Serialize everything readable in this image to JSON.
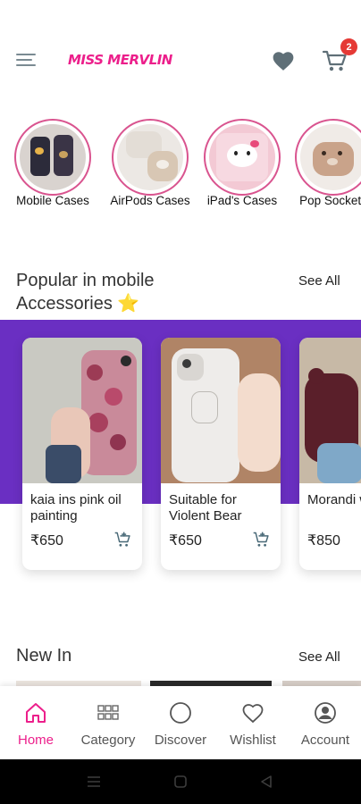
{
  "header": {
    "brand": "MISS MERVLIN",
    "cart_count": "2",
    "menu_icon": "hamburger-menu-icon",
    "wishlist_icon": "heart-icon",
    "cart_icon": "shopping-cart-icon"
  },
  "categories": [
    {
      "label": "Mobile Cases"
    },
    {
      "label": "AirPods Cases"
    },
    {
      "label": "iPad's Cases"
    },
    {
      "label": "Pop Sockets"
    }
  ],
  "popular": {
    "title_line1": "Popular in mobile",
    "title_line2": "Accessories ⭐",
    "see_all": "See All",
    "products": [
      {
        "name": "kaia ins pink oil painting",
        "price": "₹650"
      },
      {
        "name": "Suitable for Violent Bear",
        "price": "₹650"
      },
      {
        "name": "Morandi wine red",
        "price": "₹850"
      }
    ]
  },
  "new_in": {
    "title": "New In",
    "see_all": "See All"
  },
  "bottom_nav": [
    {
      "label": "Home",
      "icon": "home-icon"
    },
    {
      "label": "Category",
      "icon": "grid-icon"
    },
    {
      "label": "Discover",
      "icon": "discover-icon"
    },
    {
      "label": "Wishlist",
      "icon": "heart-outline-icon"
    },
    {
      "label": "Account",
      "icon": "account-icon"
    }
  ],
  "colors": {
    "brand": "#ec1f8b",
    "band": "#6a2fc2",
    "badge": "#e53935",
    "active_nav": "#ec1f8b"
  }
}
